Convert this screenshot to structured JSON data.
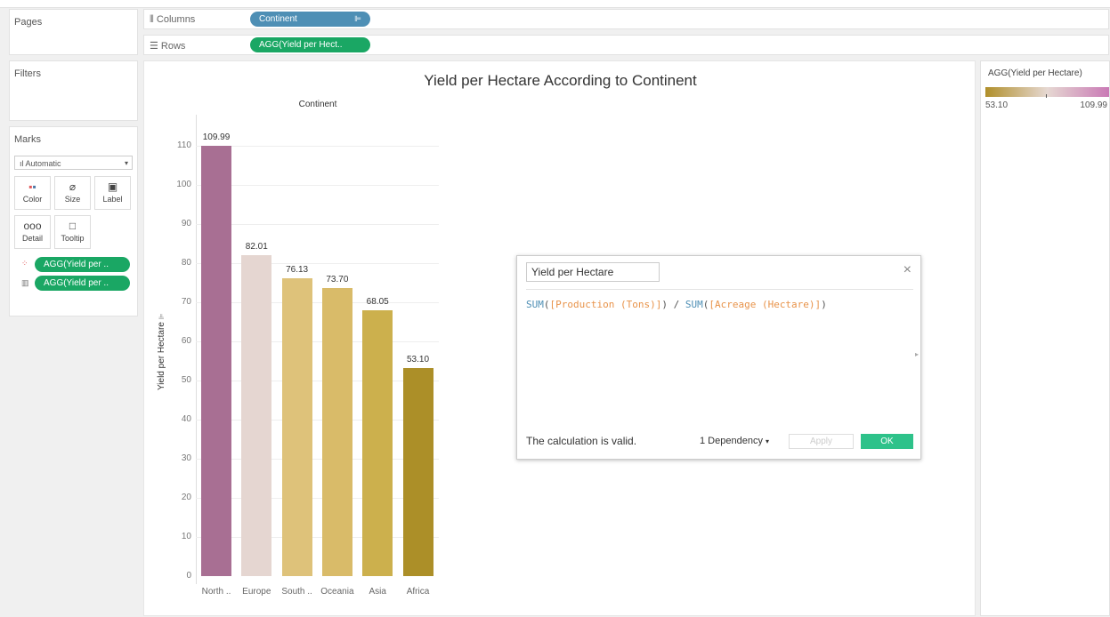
{
  "panels": {
    "pages_label": "Pages",
    "filters_label": "Filters",
    "marks_label": "Marks"
  },
  "shelves": {
    "columns_label": "Columns",
    "columns_pill": "Continent",
    "rows_label": "Rows",
    "rows_pill": "AGG(Yield per Hect.."
  },
  "marks": {
    "type": "Automatic",
    "buttons": [
      {
        "label": "Color",
        "icon": "color-dots-icon"
      },
      {
        "label": "Size",
        "icon": "size-icon"
      },
      {
        "label": "Label",
        "icon": "label-icon"
      },
      {
        "label": "Detail",
        "icon": "detail-icon"
      },
      {
        "label": "Tooltip",
        "icon": "tooltip-icon"
      }
    ],
    "pills": [
      {
        "label": "AGG(Yield per ..",
        "icon": "color-dots-icon"
      },
      {
        "label": "AGG(Yield per ..",
        "icon": "label-icon"
      }
    ]
  },
  "legend": {
    "title": "AGG(Yield per Hectare)",
    "min": "53.10",
    "max": "109.99",
    "color_low": "#b08f2a",
    "color_mid": "#e6d8d2",
    "color_high": "#c979b5"
  },
  "chart_data": {
    "type": "bar",
    "title": "Yield per Hectare According to Continent",
    "column_header": "Continent",
    "ylabel": "Yield per Hectare",
    "categories": [
      "North ..",
      "Europe",
      "South ..",
      "Oceania",
      "Asia",
      "Africa"
    ],
    "values": [
      109.99,
      82.01,
      76.13,
      73.7,
      68.05,
      53.1
    ],
    "value_labels": [
      "109.99",
      "82.01",
      "76.13",
      "73.70",
      "68.05",
      "53.10"
    ],
    "colors": [
      "#a86f93",
      "#e5d6d1",
      "#dec27a",
      "#d9bb69",
      "#ccb04d",
      "#ac8f28"
    ],
    "yticks": [
      0,
      10,
      20,
      30,
      40,
      50,
      60,
      70,
      80,
      90,
      100,
      110
    ],
    "ylim": [
      0,
      110
    ],
    "grid": true
  },
  "calc_dialog": {
    "name": "Yield per Hectare",
    "formula_fn1": "SUM",
    "formula_field1": "[Production (Tons)]",
    "formula_op": " / ",
    "formula_fn2": "SUM",
    "formula_field2": "[Acreage (Hectare)]",
    "status": "The calculation is valid.",
    "dependency": "1 Dependency",
    "apply_label": "Apply",
    "ok_label": "OK",
    "close_glyph": "×",
    "fn_color": "#4e8fb5",
    "field_color": "#e8934a"
  }
}
